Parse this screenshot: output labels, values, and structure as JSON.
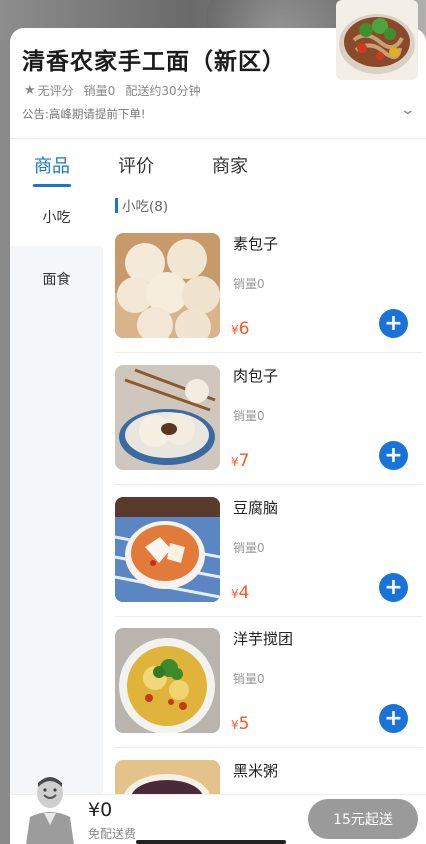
{
  "shop": {
    "name": "清香农家手工面（新区）",
    "rating": "无评分",
    "sales": "销量0",
    "delivery_time": "配送约30分钟",
    "notice": "公告:高峰期请提前下单!",
    "photo_icon": "noodle-dish-photo"
  },
  "tabs": [
    {
      "label": "商品",
      "active": true
    },
    {
      "label": "评价",
      "active": false
    },
    {
      "label": "商家",
      "active": false
    }
  ],
  "categories": [
    {
      "label": "小吃",
      "active": true
    },
    {
      "label": "面食",
      "active": false
    }
  ],
  "section": {
    "title": "小吃(8)"
  },
  "items": [
    {
      "name": "素包子",
      "sales": "销量0",
      "currency": "¥",
      "price": "6",
      "image": "steamed-buns-photo"
    },
    {
      "name": "肉包子",
      "sales": "销量0",
      "currency": "¥",
      "price": "7",
      "image": "meat-buns-photo"
    },
    {
      "name": "豆腐脑",
      "sales": "销量0",
      "currency": "¥",
      "price": "4",
      "image": "tofu-pudding-photo"
    },
    {
      "name": "洋芋搅团",
      "sales": "销量0",
      "currency": "¥",
      "price": "5",
      "image": "potato-dish-photo"
    },
    {
      "name": "黑米粥",
      "sales": "",
      "currency": "",
      "price": "",
      "image": "black-rice-porridge-photo"
    }
  ],
  "cart": {
    "total": "¥0",
    "delivery_fee": "免配送费",
    "min_order": "15元起送"
  },
  "colors": {
    "accent": "#1a73d9",
    "price": "#ff5722",
    "disabled_button": "#9a9a9a"
  }
}
